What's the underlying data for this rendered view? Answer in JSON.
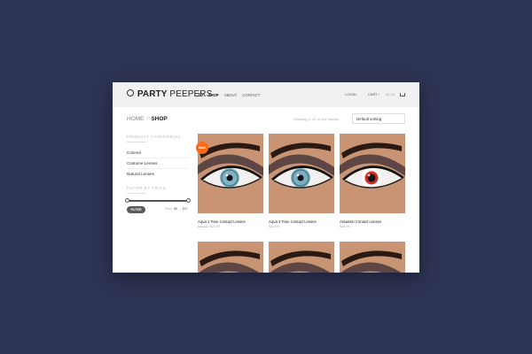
{
  "brand": {
    "logo_bold": "PARTY",
    "logo_light": " PEEPERS"
  },
  "nav": {
    "items": [
      {
        "label": "SHOP",
        "active": true
      },
      {
        "label": "ABOUT",
        "active": false
      },
      {
        "label": "CONTACT",
        "active": false
      }
    ]
  },
  "account": {
    "login": "LOGIN",
    "cart": "CART /",
    "cart_amount": "$0.00"
  },
  "breadcrumb": {
    "home": "HOME",
    "separator": "/",
    "current": "SHOP"
  },
  "shop": {
    "results_text": "Showing 1–12 of 144 results",
    "sorting": "Default sorting"
  },
  "sidebar": {
    "categories_title": "PRODUCT CATEGORIES",
    "categories": [
      "Colored",
      "Costume Lenses",
      "Natural Lenses"
    ],
    "price_title": "FILTER BY PRICE",
    "filter_button": "FILTER",
    "price_prefix": "Price:",
    "price_min": "$9",
    "price_sep": "—",
    "price_max": "$37"
  },
  "products": [
    {
      "name": "Aqua 1 Tone Contact Lenses",
      "old_price": "$24.99",
      "price": "$22.99",
      "sale": true,
      "sale_label": "Sale!",
      "iris_color": "#7fb4c4"
    },
    {
      "name": "Aqua 3 Tone Contact Lenses",
      "old_price": "",
      "price": "$22.99",
      "sale": false,
      "iris_color": "#79aec3"
    },
    {
      "name": "Assassin Contact Lenses",
      "old_price": "",
      "price": "$28.99",
      "sale": false,
      "iris_color": "#d62a1f"
    },
    {
      "name": "",
      "old_price": "",
      "price": "",
      "sale": false,
      "iris_color": "#9a6b48"
    },
    {
      "name": "",
      "old_price": "",
      "price": "",
      "sale": false,
      "iris_color": "#9a6b48"
    },
    {
      "name": "",
      "old_price": "",
      "price": "",
      "sale": false,
      "iris_color": "#9a6b48"
    }
  ],
  "colors": {
    "background": "#2d3352",
    "accent": "#ff6a13",
    "header_bg": "#f1f1f1",
    "skin": "#c89474"
  }
}
